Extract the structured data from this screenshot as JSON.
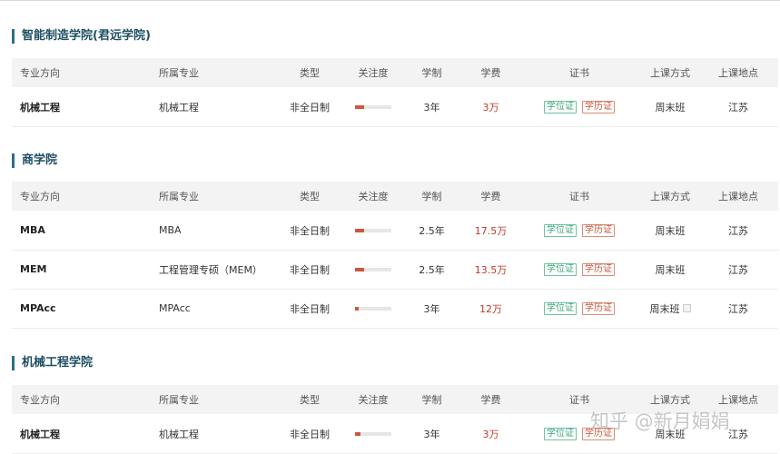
{
  "columns": {
    "direction": "专业方向",
    "major": "所属专业",
    "type": "类型",
    "attention": "关注度",
    "length": "学制",
    "fee": "学费",
    "certificate": "证书",
    "mode": "上课方式",
    "location": "上课地点"
  },
  "badges": {
    "degree": "学位证",
    "diploma": "学历证"
  },
  "colors": {
    "accent": "#1f4e63",
    "fee": "#c0392b",
    "bar": "#c8593f",
    "badge_green": "#3aa57a",
    "badge_red": "#c4573b"
  },
  "sections": [
    {
      "title": "智能制造学院(君远学院)",
      "rows": [
        {
          "direction": "机械工程",
          "major": "机械工程",
          "type": "非全日制",
          "attention": 0.25,
          "length": "3年",
          "fee": "3万",
          "mode": "周末班",
          "location": "江苏"
        }
      ]
    },
    {
      "title": "商学院",
      "rows": [
        {
          "direction": "MBA",
          "major": "MBA",
          "type": "非全日制",
          "attention": 0.25,
          "length": "2.5年",
          "fee": "17.5万",
          "mode": "周末班",
          "location": "江苏"
        },
        {
          "direction": "MEM",
          "major": "工程管理专硕（MEM）",
          "type": "非全日制",
          "attention": 0.25,
          "length": "2.5年",
          "fee": "13.5万",
          "mode": "周末班",
          "location": "江苏"
        },
        {
          "direction": "MPAcc",
          "major": "MPAcc",
          "type": "非全日制",
          "attention": 0.1,
          "length": "3年",
          "fee": "12万",
          "mode": "周末班",
          "location": "江苏"
        }
      ]
    },
    {
      "title": "机械工程学院",
      "rows": [
        {
          "direction": "机械工程",
          "major": "机械工程",
          "type": "非全日制",
          "attention": 0.15,
          "length": "3年",
          "fee": "3万",
          "mode": "周末班",
          "location": "江苏"
        }
      ]
    }
  ],
  "watermark": "知乎 @新月娟娟"
}
